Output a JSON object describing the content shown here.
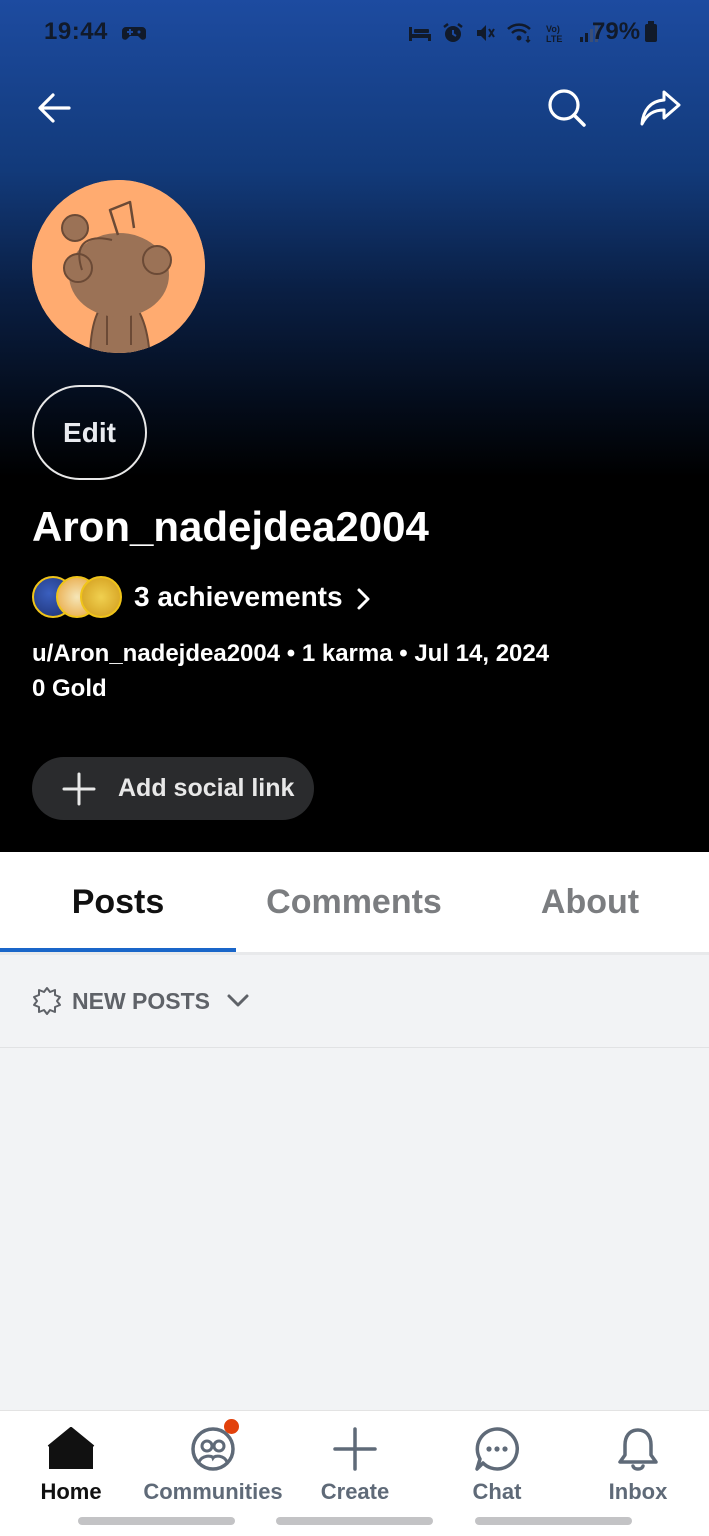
{
  "status_bar": {
    "time": "19:44",
    "battery": "79%"
  },
  "header": {
    "back_icon": "arrow-left-icon",
    "search_icon": "search-icon",
    "share_icon": "share-icon"
  },
  "profile": {
    "avatar_icon": "snoo-avatar-icon",
    "avatar_color": "#ffab70",
    "edit_label": "Edit",
    "username": "Aron_nadejdea2004",
    "achievements_label": "3 achievements",
    "meta_line": "u/Aron_nadejdea2004 • 1 karma • Jul 14, 2024",
    "gold_line": "0 Gold",
    "add_social_label": "Add social link"
  },
  "tabs": [
    {
      "label": "Posts",
      "active": true
    },
    {
      "label": "Comments",
      "active": false
    },
    {
      "label": "About",
      "active": false
    }
  ],
  "sort": {
    "label": "NEW POSTS"
  },
  "bottom_nav": [
    {
      "label": "Home",
      "icon": "home-icon",
      "active": true
    },
    {
      "label": "Communities",
      "icon": "communities-icon",
      "active": false,
      "notification": true
    },
    {
      "label": "Create",
      "icon": "plus-icon",
      "active": false
    },
    {
      "label": "Chat",
      "icon": "chat-icon",
      "active": false
    },
    {
      "label": "Inbox",
      "icon": "bell-icon",
      "active": false
    }
  ],
  "colors": {
    "accent": "#1a66c9",
    "notification": "#e2410b",
    "header_top": "#1d4ba0",
    "header_bottom": "#000000"
  }
}
